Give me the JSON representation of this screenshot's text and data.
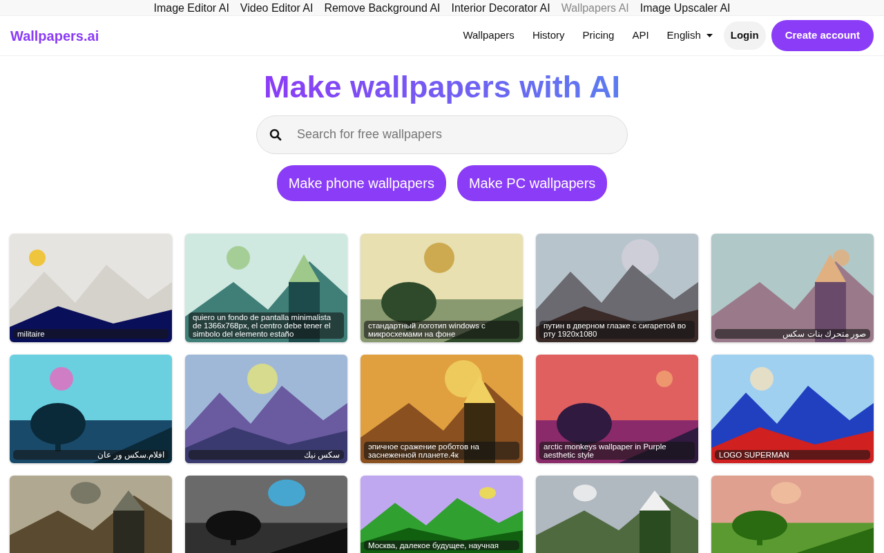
{
  "top_links": [
    {
      "label": "Image Editor AI",
      "selected": false
    },
    {
      "label": "Video Editor AI",
      "selected": false
    },
    {
      "label": "Remove Background AI",
      "selected": false
    },
    {
      "label": "Interior Decorator AI",
      "selected": false
    },
    {
      "label": "Wallpapers AI",
      "selected": true
    },
    {
      "label": "Image Upscaler AI",
      "selected": false
    }
  ],
  "brand": "Wallpapers.ai",
  "nav": [
    "Wallpapers",
    "History",
    "Pricing",
    "API"
  ],
  "language": "English",
  "login": "Login",
  "signup": "Create account",
  "headline": "Make wallpapers with AI",
  "search": {
    "placeholder": "Search for free wallpapers"
  },
  "actions": [
    "Make phone wallpapers",
    "Make PC wallpapers"
  ],
  "wallpapers": [
    {
      "caption": "militaire"
    },
    {
      "caption": "quiero un fondo de pantalla minimalista de 1366x768px, el centro debe tener el simbolo del elemento estaño"
    },
    {
      "caption": "стандартный логотип windows с микросхемами на фоне"
    },
    {
      "caption": "путин в дверном глазке с сигаретой во рту 1920x1080"
    },
    {
      "caption": "صور متحرك بنات سكس"
    },
    {
      "caption": "افلام.سكس ور عان"
    },
    {
      "caption": "سكس نيك"
    },
    {
      "caption": "эпичное сражение роботов на заснеженной планете.4к"
    },
    {
      "caption": "arctic monkeys wallpaper in Purple aesthetic style"
    },
    {
      "caption": "LOGO SUPERMAN"
    },
    {
      "kind": "picture"
    },
    {
      "kind": "picture"
    },
    {
      "caption": "Москва, далекое будущее, научная"
    },
    {
      "kind": "picture"
    },
    {
      "kind": "picture"
    }
  ]
}
